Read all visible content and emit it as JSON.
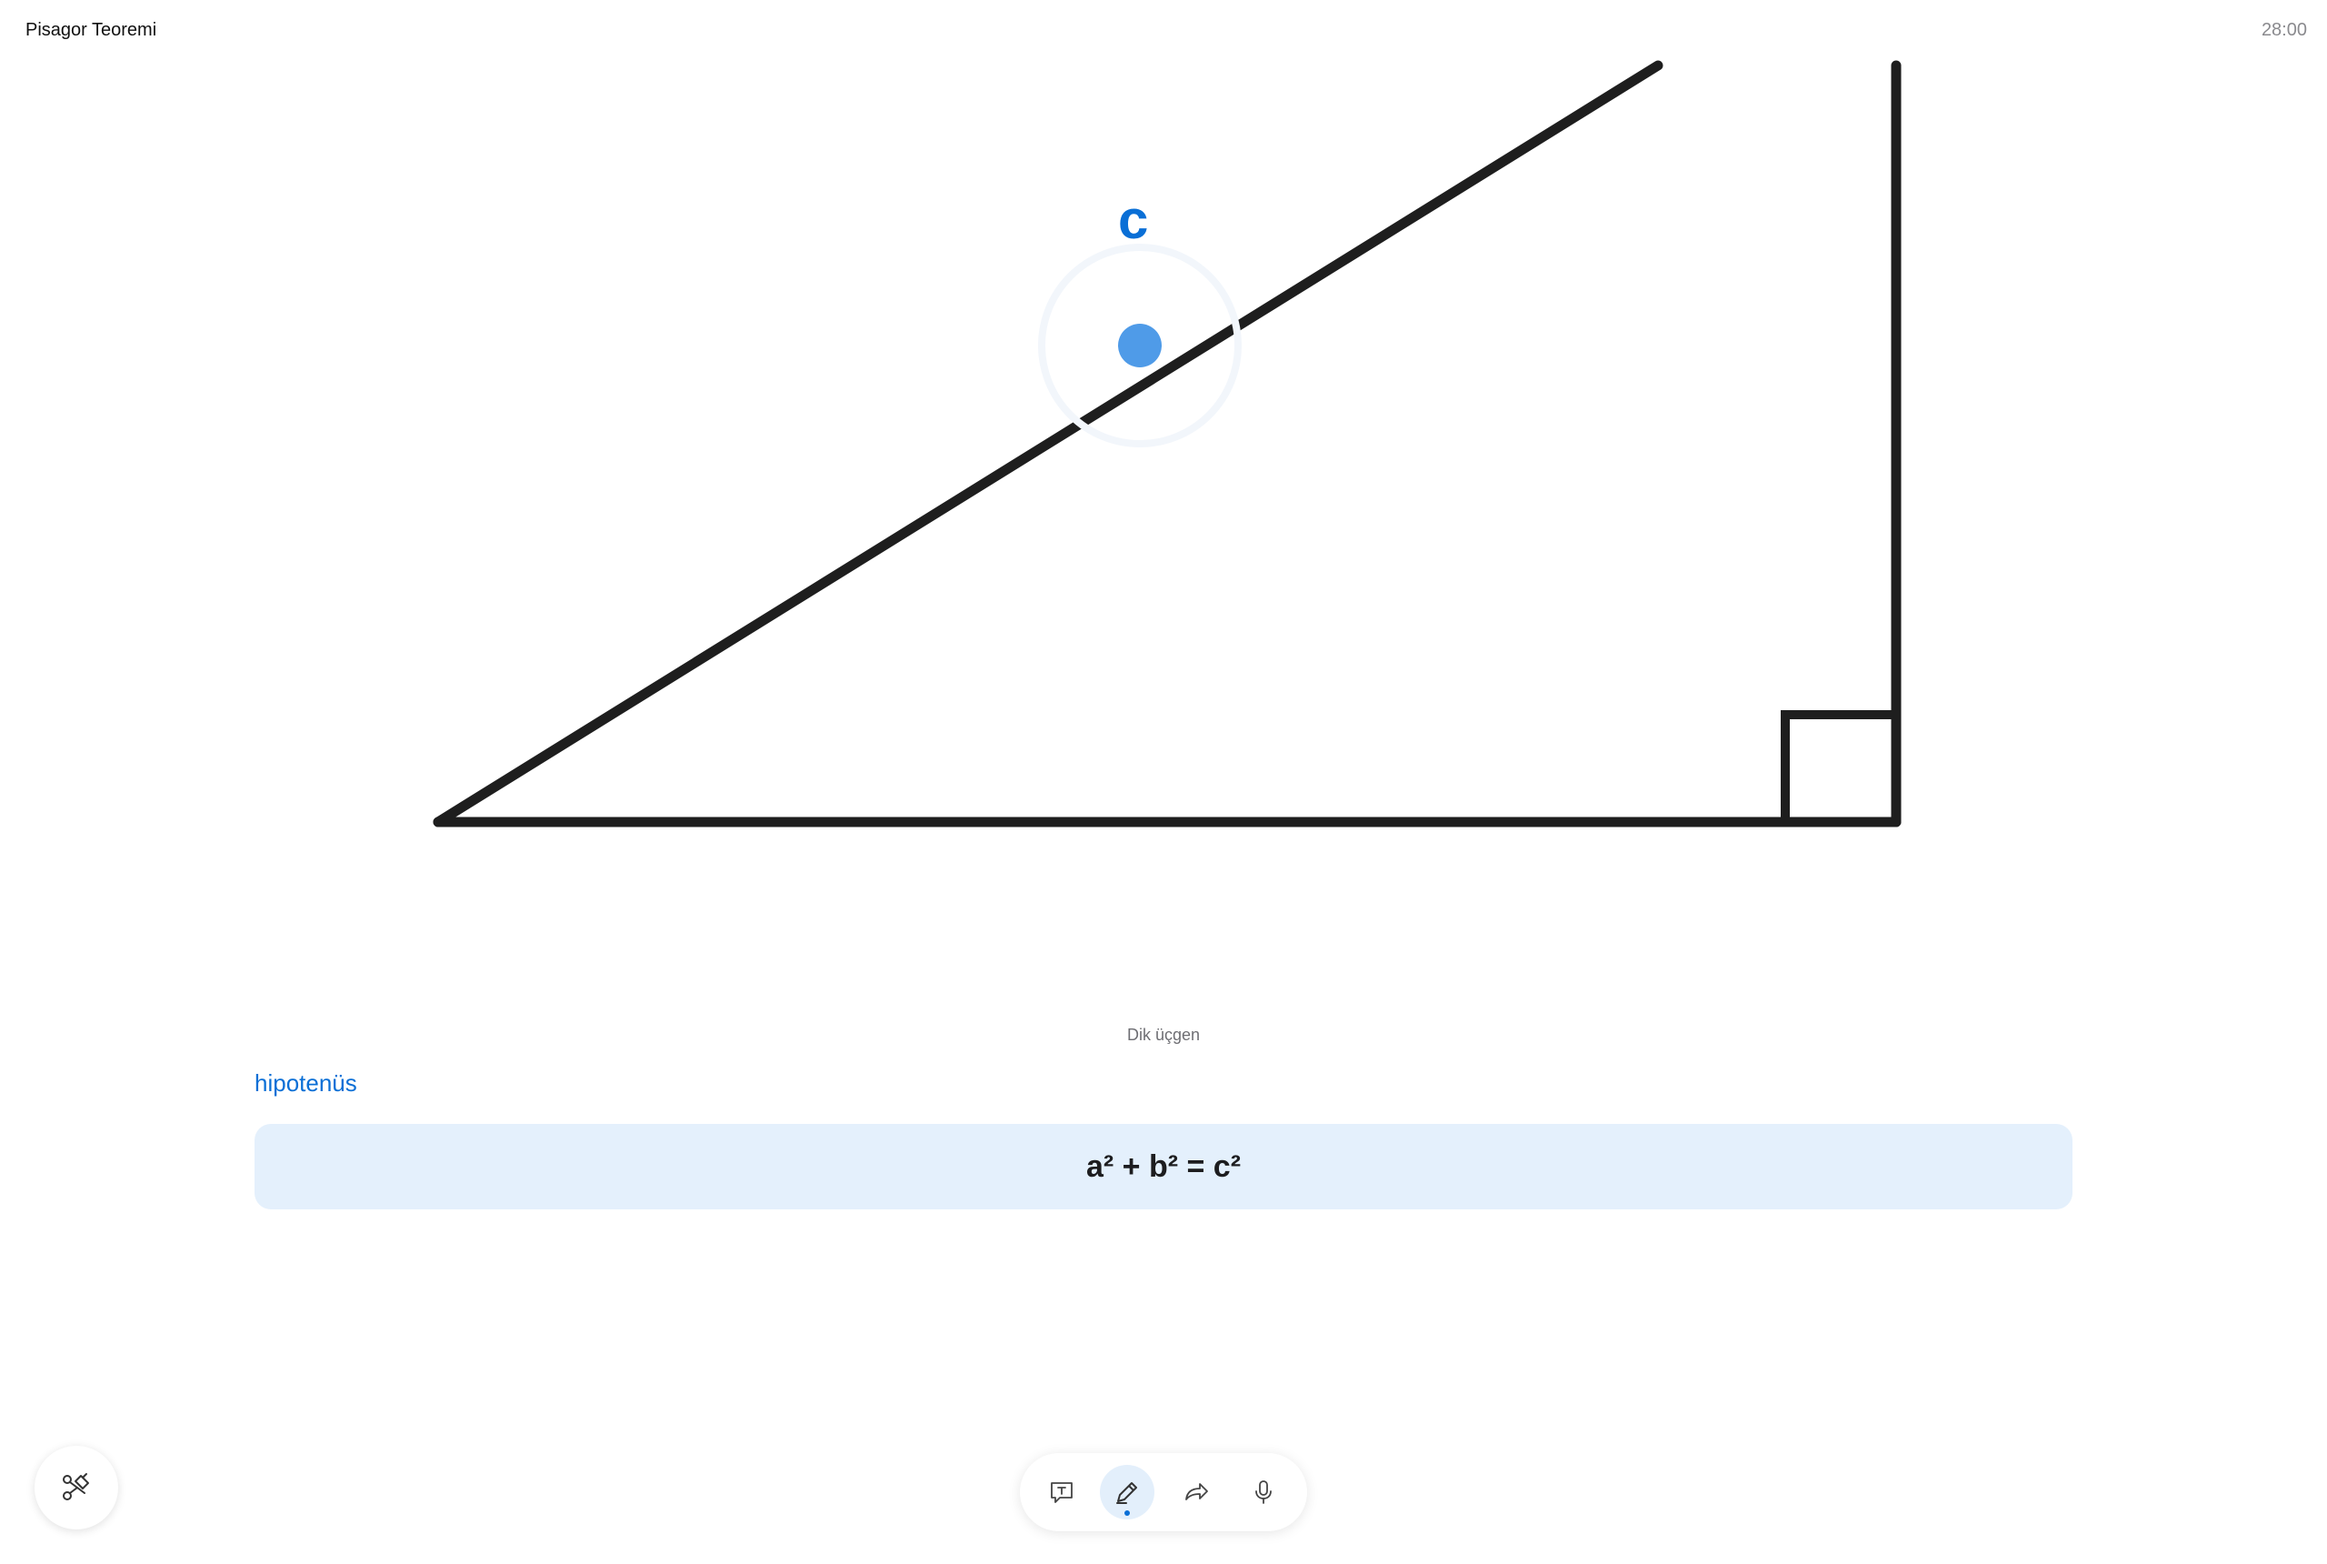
{
  "header": {
    "title": "Pisagor Teoremi",
    "timer": "28:00"
  },
  "diagram": {
    "hypotenuse_label": "c",
    "caption": "Dik üçgen"
  },
  "content": {
    "term": "hipotenüs",
    "formula": "a² + b² = c²"
  },
  "colors": {
    "accent": "#0a6fd6",
    "marker": "#4f9be8",
    "formula_bg": "#e4f0fc",
    "stroke": "#1e1e1e"
  },
  "icons": {
    "fab": "tools-icon",
    "text": "text-bubble-icon",
    "pencil": "pencil-icon",
    "share": "share-arrow-icon",
    "mic": "microphone-icon"
  },
  "toolbar": {
    "active_tool": "pencil"
  }
}
